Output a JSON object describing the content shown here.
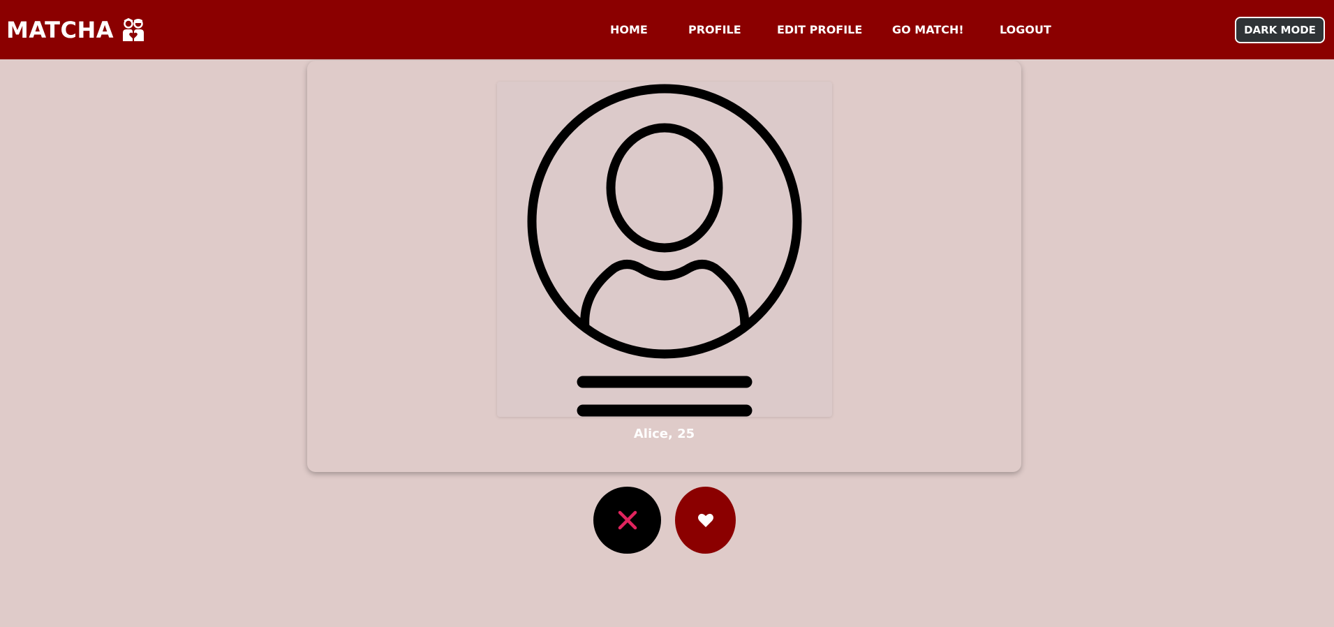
{
  "app": {
    "brand_name": "MATCHA",
    "brand_icon": "couple-heart-icon"
  },
  "nav": {
    "items": [
      {
        "label": "HOME"
      },
      {
        "label": "PROFILE"
      },
      {
        "label": "EDIT PROFILE"
      },
      {
        "label": "GO MATCH!"
      },
      {
        "label": "LOGOUT"
      }
    ],
    "dark_mode_label": "DARK MODE"
  },
  "profile_card": {
    "photo_icon": "default-avatar-icon",
    "name_age": "Alice, 25"
  },
  "actions": {
    "reject_icon": "close-icon",
    "like_icon": "heart-icon"
  },
  "colors": {
    "brand": "#8b0000",
    "background": "#dfcbc9",
    "reject_icon": "#e0245e",
    "dark_button": "#2f3336"
  }
}
